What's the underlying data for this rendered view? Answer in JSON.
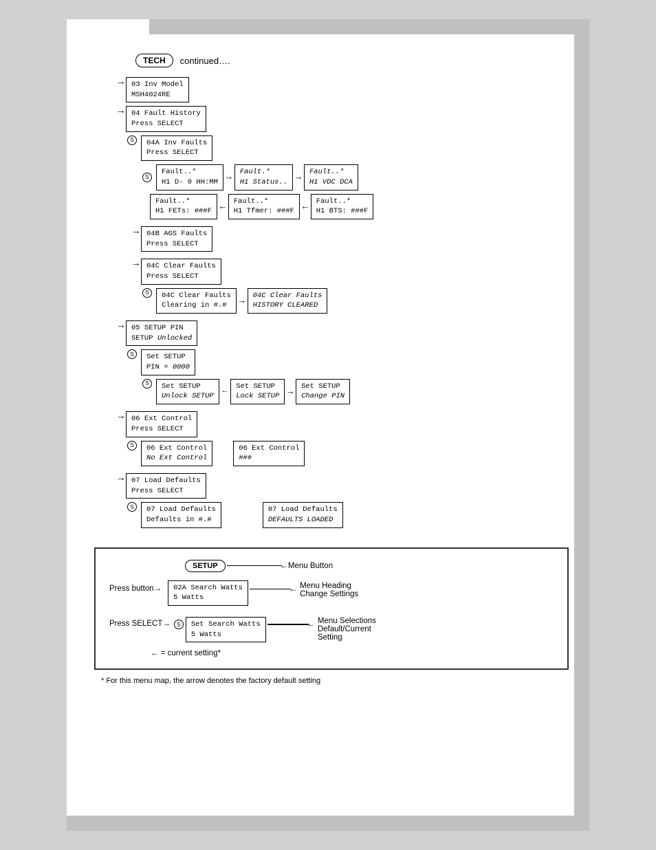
{
  "header": {
    "continued": "continued….",
    "tech_label": "TECH"
  },
  "flow": {
    "inv_model": {
      "line1": "03 Inv Model",
      "line2": "MSH4024RE"
    },
    "fault_history": {
      "line1": "04 Fault History",
      "line2": "Press SELECT"
    },
    "inv_faults": {
      "line1": "04A Inv Faults",
      "line2": "Press SELECT"
    },
    "fault_boxes": [
      {
        "line1": "Fault..*",
        "line2": "H1 D-   0 HH:MM",
        "italic2": false
      },
      {
        "line1": "Fault.*",
        "line2": "H1    Status..",
        "italic1": true
      },
      {
        "line1": "Fault..*",
        "line2": "H1 VDC    DCA",
        "italic1": true
      }
    ],
    "fault_boxes2": [
      {
        "line1": "Fault..*",
        "line2": "H1 FETs:    ###F"
      },
      {
        "line1": "Fault..*",
        "line2": "H1 Tfmer:   ###F"
      },
      {
        "line1": "Fault..*",
        "line2": "H1 BTS:     ###F"
      }
    ],
    "agb_faults": {
      "line1": "04B AGS Faults",
      "line2": "Press SELECT"
    },
    "clear_faults": {
      "line1": "04C Clear Faults",
      "line2": "Press SELECT"
    },
    "clear_faults_sub1": {
      "line1": "04C Clear Faults",
      "line2": "Clearing in  #.#"
    },
    "clear_faults_sub2": {
      "line1": "04C Clear Faults",
      "line2": "HISTORY CLEARED"
    },
    "setup_pin": {
      "line1": "05 SETUP PIN",
      "line2": "SETUP Unlocked"
    },
    "set_setup_pin": {
      "line1": "Set SETUP",
      "line2": "PIN =       0000"
    },
    "set_setup_sub1": {
      "line1": "Set SETUP",
      "line2": "Unlock SETUP",
      "italic2": true
    },
    "set_setup_sub2": {
      "line1": "Set SETUP",
      "line2": "Lock SETUP",
      "italic2": true
    },
    "set_setup_sub3": {
      "line1": "Set SETUP",
      "line2": "Change PIN",
      "italic2": true
    },
    "ext_control": {
      "line1": "06 Ext Control",
      "line2": "Press SELECT"
    },
    "ext_control_sub1": {
      "line1": "06 Ext Control",
      "line2": "No Ext Control",
      "italic2": true
    },
    "ext_control_sub2": {
      "line1": "06 Ext Control",
      "line2": "###"
    },
    "load_defaults": {
      "line1": "07 Load Defaults",
      "line2": "Press SELECT"
    },
    "load_defaults_sub1": {
      "line1": "07 Load Defaults",
      "line2": "Defaults in #.#"
    },
    "load_defaults_sub2": {
      "line1": "07 Load Defaults",
      "line2": "DEFAULTS LOADED",
      "italic2": true
    }
  },
  "legend": {
    "setup_label": "SETUP",
    "menu_button_label": "Menu Button",
    "press_button_label": "Press button→",
    "menu_item_line1": "02A Search Watts",
    "menu_item_line2": "5 Watts",
    "menu_heading_label": "Menu Heading",
    "change_settings_label": "Change Settings",
    "press_select_label": "Press SELECT→",
    "set_item_line1": "Set Search Watts",
    "set_item_line2": "5 Watts",
    "menu_selections_label": "Menu Selections",
    "default_current_label": "Default/Current",
    "setting_label": "Setting",
    "current_setting": "← = current setting*",
    "footnote": "* For this menu map, the arrow denotes the factory default setting"
  }
}
